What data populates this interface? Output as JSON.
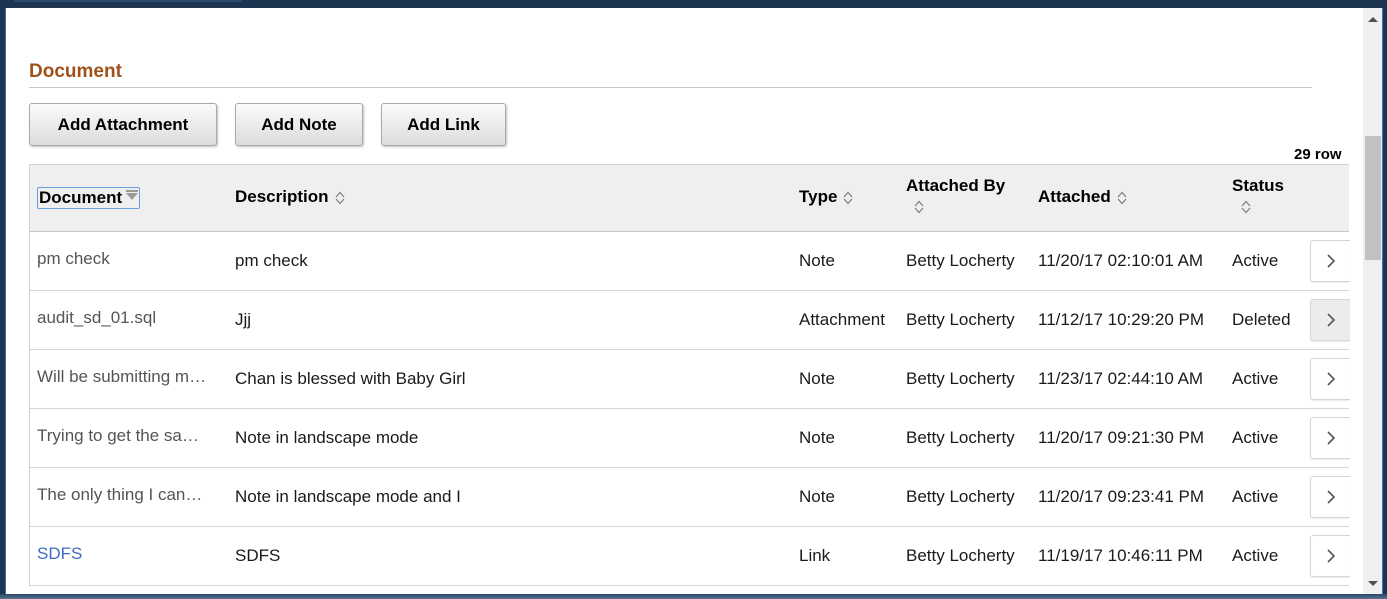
{
  "section": {
    "title": "Document"
  },
  "toolbar": {
    "add_attachment_label": "Add Attachment",
    "add_note_label": "Add Note",
    "add_link_label": "Add Link"
  },
  "grid": {
    "row_count_label": "29 row",
    "columns": {
      "document": "Document",
      "description": "Description",
      "type": "Type",
      "attached_by": "Attached By",
      "attached": "Attached",
      "status": "Status"
    },
    "rows": [
      {
        "document": "pm check",
        "description": "pm check",
        "type": "Note",
        "attached_by": "Betty Locherty",
        "attached": "11/20/17 02:10:01 AM",
        "status": "Active"
      },
      {
        "document": "audit_sd_01.sql",
        "description": "Jjj",
        "type": "Attachment",
        "attached_by": "Betty Locherty",
        "attached": "11/12/17 10:29:20 PM",
        "status": "Deleted"
      },
      {
        "document": "Will be submitting m…",
        "description": "Chan is blessed with Baby Girl",
        "type": "Note",
        "attached_by": "Betty Locherty",
        "attached": "11/23/17 02:44:10 AM",
        "status": "Active"
      },
      {
        "document": "Trying to get the sa…",
        "description": "Note in landscape mode",
        "type": "Note",
        "attached_by": "Betty Locherty",
        "attached": "11/20/17 09:21:30 PM",
        "status": "Active"
      },
      {
        "document": "The only thing I can…",
        "description": "Note in landscape mode and I",
        "type": "Note",
        "attached_by": "Betty Locherty",
        "attached": "11/20/17 09:23:41 PM",
        "status": "Active"
      },
      {
        "document": "SDFS",
        "description": "SDFS",
        "type": "Link",
        "attached_by": "Betty Locherty",
        "attached": "11/19/17 10:46:11 PM",
        "status": "Active"
      }
    ]
  },
  "colors": {
    "section_title": "#a0521b",
    "link": "#3f6bc4",
    "header_bg": "#efefef"
  }
}
